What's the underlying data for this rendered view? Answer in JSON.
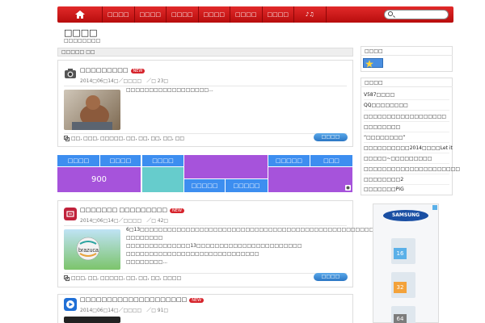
{
  "nav": {
    "items": [
      "□□□□",
      "□□□□",
      "□□□□",
      "□□□□",
      "□□□□",
      "□□□□",
      "♪♫"
    ],
    "search_placeholder": ""
  },
  "site": {
    "title": "□□□□",
    "subtitle": "□□□□□□□□"
  },
  "breadcrumb": "□□□□□ □□",
  "posts": [
    {
      "title": "□□□□□□□□□",
      "badge": "NEW",
      "meta": "2014□06□14□／□□□□　／□ 23□",
      "excerpt": "□□□□□□□□□□□□□□□□□□...",
      "tags": "□□, □□□, □□□□□, □□, □□, □□, □□, □□",
      "more": "□□□□"
    },
    {
      "title": "□□□□□□□ □□□□□□□□□",
      "badge": "NEW",
      "meta": "2014□06□14□／□□□□　／□ 42□",
      "excerpt_lines": [
        "6□13□□□□□□□□□□□□□□□□□□□□□□□□□□□□□□□□□□□□□□□□□□□□□□□□□□□□□□ □□□□□□□□",
        "□□□□□□□□□□□□□□13□□□□□□□□□□□□□□□□□□□□□□□ □□□□□□□□□□□□□□□□□□□□□□□□□□□□□",
        "□□□□□□□□..."
      ],
      "thumb_label": "brazuca",
      "tags": "□□□, □□, □□□□□, □□, □□, □□, □□□□",
      "more": "□□□□"
    },
    {
      "title": "□□□□□□□□□□□□□□□□□□□□",
      "badge": "NEW",
      "meta": "2014□06□14□／□□□□　／□ 91□"
    }
  ],
  "tiles": {
    "row1": [
      "□□□□",
      "□□□□",
      "□□□□",
      "□□□□□",
      "□□□"
    ],
    "big_number": "900",
    "row2": [
      "□□□□□",
      "□□□□□"
    ]
  },
  "sidebar": {
    "widget1_title": "□□□□",
    "widget2_title": "□□□□",
    "links": [
      "V587□□□□",
      "QQ□□□□□□□□",
      "□□□□□□□□□□□□□□□□□□",
      "□□□□□□□□",
      "“□□□□□□□□”",
      "□□□□□□□□□□2014□□□□Let it",
      "□□□□□~□□□□□□□□□",
      "□□□□□□□□□□□□□□□□□□□□□",
      "□□□□□□□□2",
      "□□□□□□□PIG"
    ],
    "ad_brand": "SAMSUNG",
    "ad_sizes": [
      "16",
      "32",
      "64"
    ]
  },
  "colors": {
    "nav_red": "#c81212",
    "tile_blue": "#3d8ef0",
    "tile_purple": "#a653db",
    "tile_teal": "#66cccc",
    "button_blue": "#2f7fcf"
  }
}
